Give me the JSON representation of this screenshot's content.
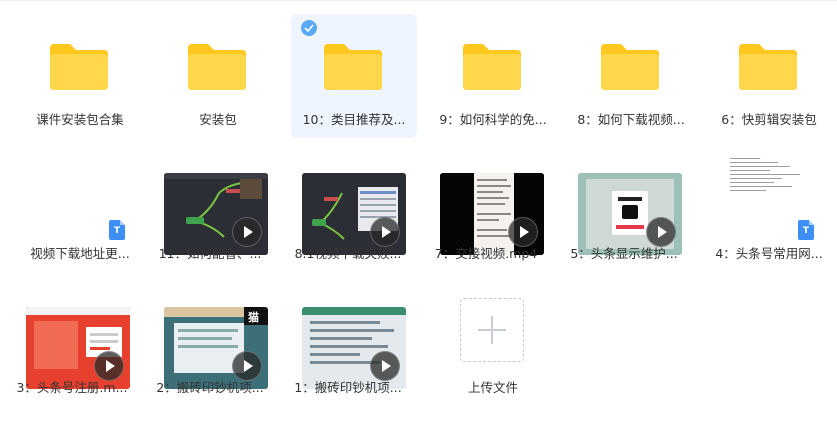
{
  "colors": {
    "folder": "#ffd74a",
    "folder_tab": "#ffc81f",
    "selected_bg": "#eef5ff",
    "check": "#5aa9f5",
    "doc_badge": "#3e8ef7"
  },
  "items": [
    {
      "name": "课件安装包合集",
      "type": "folder"
    },
    {
      "name": "安装包",
      "type": "folder"
    },
    {
      "name": "10：类目推荐及...",
      "type": "folder",
      "selected": true
    },
    {
      "name": "9：如何科学的免...",
      "type": "folder"
    },
    {
      "name": "8：如何下载视频...",
      "type": "folder"
    },
    {
      "name": "6：快剪辑安装包",
      "type": "folder"
    },
    {
      "name": "视频下载地址更...",
      "type": "doc",
      "badge": "T"
    },
    {
      "name": "11：如何配音、...",
      "type": "video"
    },
    {
      "name": "8.1视频下载失败...",
      "type": "video"
    },
    {
      "name": "7：交接视频.mp4",
      "type": "video"
    },
    {
      "name": "5：头条显示维护...",
      "type": "video"
    },
    {
      "name": "4：头条号常用网...",
      "type": "doc",
      "badge": "T"
    },
    {
      "name": "3：头条号注册.m...",
      "type": "video"
    },
    {
      "name": "2：搬砖印钞机项...",
      "type": "video"
    },
    {
      "name": "1：搬砖印钞机项...",
      "type": "video"
    },
    {
      "name": "上传文件",
      "type": "upload"
    }
  ],
  "thumb_text": {
    "tile11": "猫"
  }
}
